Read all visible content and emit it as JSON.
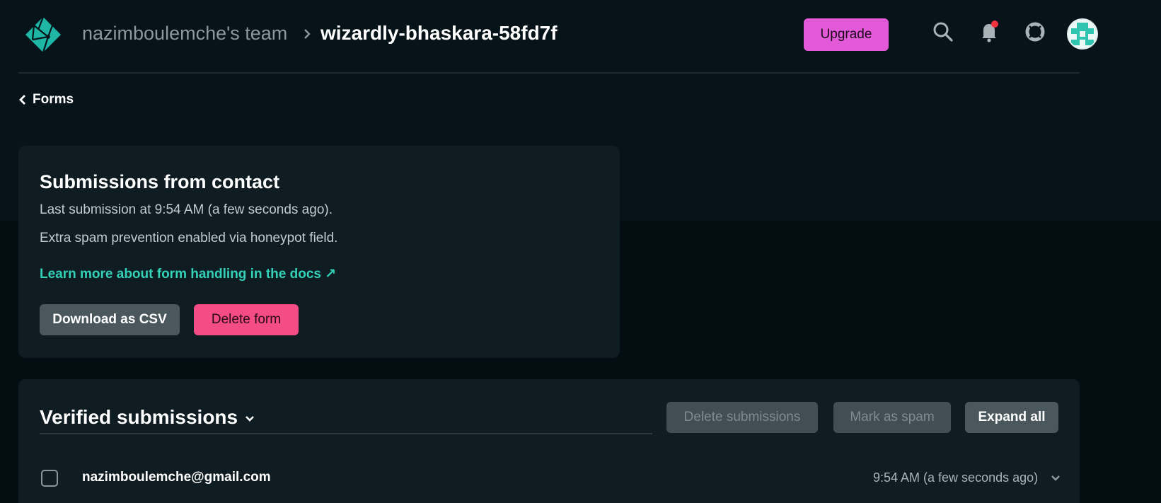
{
  "header": {
    "team_name": "nazimboulemche's team",
    "site_name": "wizardly-bhaskara-58fd7f",
    "upgrade_label": "Upgrade",
    "icons": [
      "netlify-logo-icon",
      "search-icon",
      "bell-icon",
      "help-icon",
      "avatar"
    ],
    "notification_dot_color": "#f5323f"
  },
  "nav": {
    "back_label": "Forms"
  },
  "form_card": {
    "title": "Submissions from contact",
    "last_submission": "Last submission at 9:54 AM (a few seconds ago).",
    "spam_note": "Extra spam prevention enabled via honeypot field.",
    "docs_link": "Learn more about form handling in the docs ↗",
    "download_csv_label": "Download as CSV",
    "delete_form_label": "Delete form"
  },
  "submissions": {
    "title": "Verified submissions",
    "delete_label": "Delete submissions",
    "spam_label": "Mark as spam",
    "expand_label": "Expand all",
    "rows": [
      {
        "email": "nazimboulemche@gmail.com",
        "time": "9:54 AM (a few seconds ago)"
      }
    ]
  },
  "colors": {
    "accent_teal": "#32d1b8",
    "upgrade_pink": "#e25ad8",
    "danger_pink": "#f44c84",
    "background": "#06141a"
  }
}
